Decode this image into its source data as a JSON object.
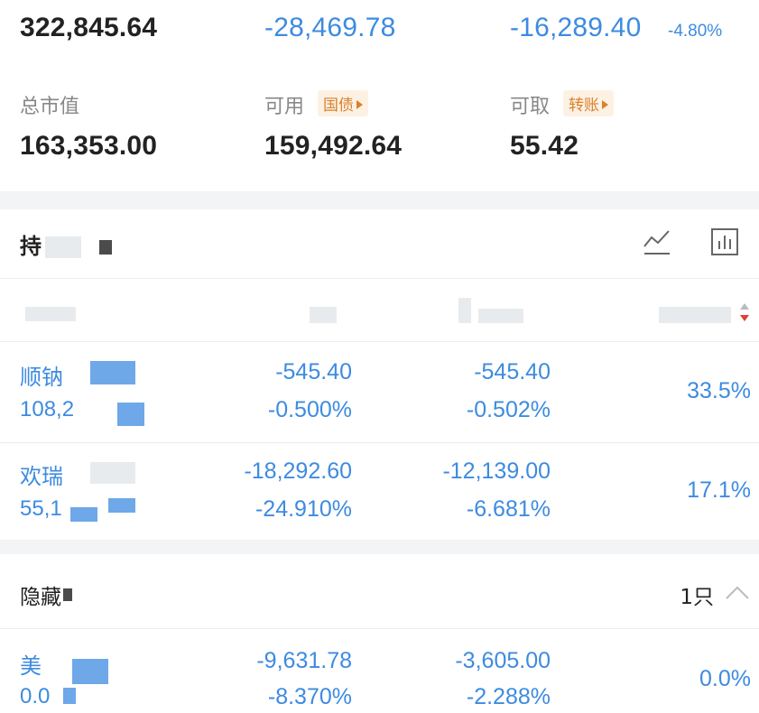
{
  "summary": {
    "total_assets": "322,845.64",
    "floating_pl": "-28,469.78",
    "today_pl": "-16,289.40",
    "today_pl_pct": "-4.80%",
    "market_value_label": "总市值",
    "market_value": "163,353.00",
    "available_label": "可用",
    "available_tag": "国债",
    "available": "159,492.64",
    "withdrawable_label": "可取",
    "withdrawable_tag": "转账",
    "withdrawable": "55.42"
  },
  "holdings": {
    "title": "持",
    "icons": [
      "line-chart-icon",
      "bar-chart-icon"
    ],
    "rows": [
      {
        "name": "顺钠",
        "sub": "108,2",
        "pl": "-545.40",
        "pl_pct": "-0.500%",
        "today_pl": "-545.40",
        "today_pct": "-0.502%",
        "position": "33.5%"
      },
      {
        "name": "欢瑞",
        "sub": "55,1",
        "pl": "-18,292.60",
        "pl_pct": "-24.910%",
        "today_pl": "-12,139.00",
        "today_pct": "-6.681%",
        "position": "17.1%"
      }
    ]
  },
  "hidden": {
    "title": "隐藏",
    "count": "1只",
    "rows": [
      {
        "name": "美",
        "sub": "0.0",
        "pl": "-9,631.78",
        "pl_pct": "-8.370%",
        "today_pl": "-3,605.00",
        "today_pct": "-2.288%",
        "position": "0.0%"
      }
    ]
  },
  "colors": {
    "blue": "#3d8be0",
    "orange": "#d9822b",
    "red": "#e0403a"
  }
}
